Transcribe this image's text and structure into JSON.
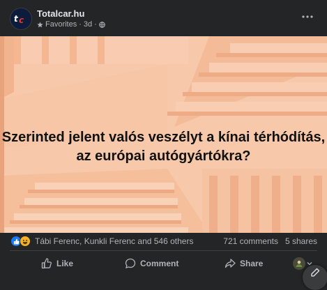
{
  "post": {
    "page_name": "Totalcar.hu",
    "audience": "Favorites",
    "separator": "·",
    "time": "3d",
    "image_text": "Szerinted jelent valós veszélyt a kínai térhódítás, az európai autógyártókra?"
  },
  "reactions": {
    "names": "Tábi Ferenc, Kunkli Ferenc and 546 others",
    "comments": "721 comments",
    "shares": "5 shares"
  },
  "actions": {
    "like_label": "Like",
    "comment_label": "Comment",
    "share_label": "Share"
  },
  "colors": {
    "background": "#242526",
    "image_peach": "#f7c4a3",
    "like_blue": "#1877f2",
    "haha_yellow": "#f7b125"
  },
  "icons": [
    "logo-icon",
    "star-icon",
    "globe-icon",
    "more-icon",
    "like-reaction-icon",
    "haha-reaction-icon",
    "like-icon",
    "comment-icon",
    "share-icon",
    "chevron-down-icon",
    "compose-icon"
  ]
}
